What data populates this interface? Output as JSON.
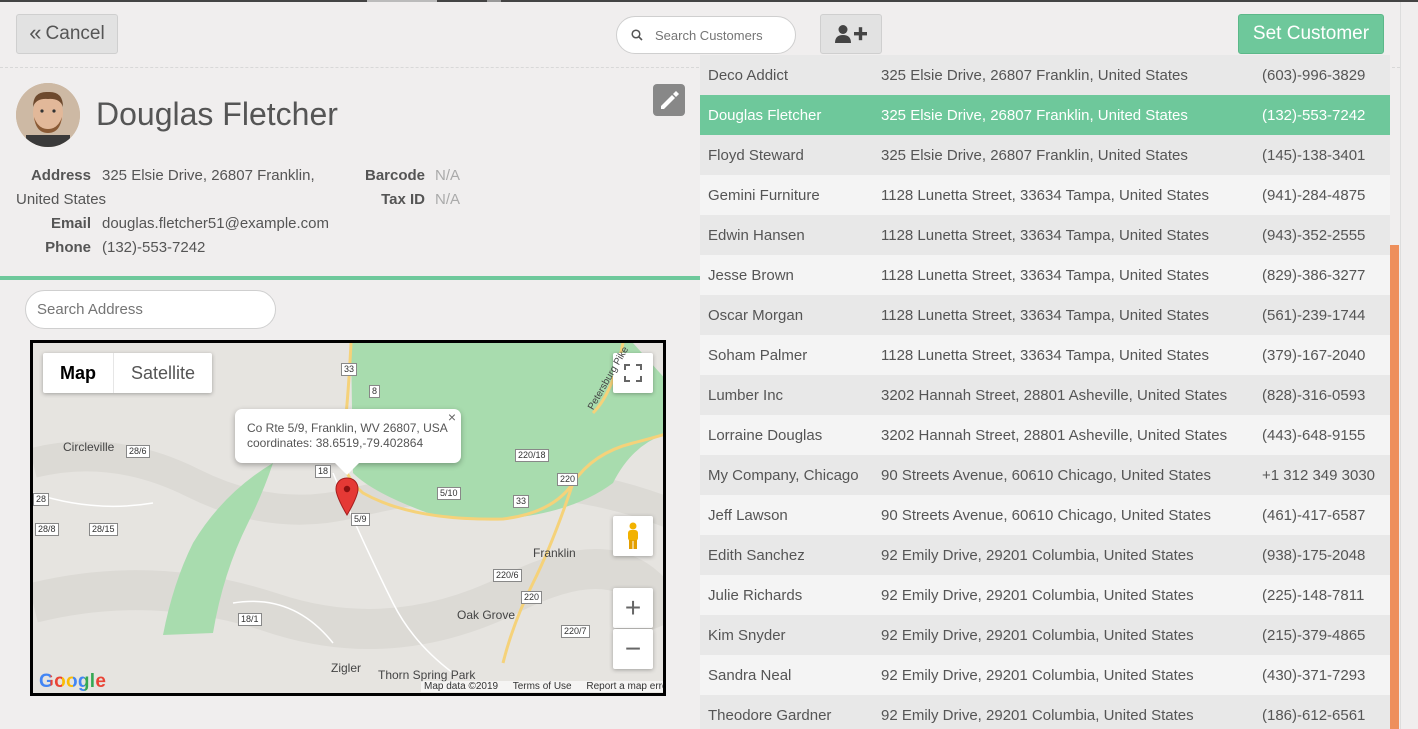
{
  "header": {
    "cancel_label": "Cancel",
    "search_placeholder": "Search Customers",
    "set_customer_label": "Set Customer"
  },
  "client": {
    "name": "Douglas Fletcher",
    "address_label": "Address",
    "address_line1": "325 Elsie Drive, 26807 Franklin,",
    "address_line2": "United States",
    "email_label": "Email",
    "email": "douglas.fletcher51@example.com",
    "phone_label": "Phone",
    "phone": "(132)-553-7242",
    "barcode_label": "Barcode",
    "barcode": "N/A",
    "taxid_label": "Tax ID",
    "taxid": "N/A",
    "search_address_placeholder": "Search Address"
  },
  "map": {
    "type_map": "Map",
    "type_satellite": "Satellite",
    "info_line1": "Co Rte 5/9, Franklin, WV 26807, USA",
    "info_line2": "coordinates: 38.6519,-79.402864",
    "places": {
      "circleville": "Circleville",
      "franklin": "Franklin",
      "oak_grove": "Oak Grove",
      "zigler": "Zigler",
      "thorn_spring_park": "Thorn Spring Park",
      "petersburg_pike": "Petersburg Pike"
    },
    "shields": {
      "r33a": "33",
      "r8": "8",
      "r286": "28/6",
      "r18": "18",
      "r220_18": "220/18",
      "r510": "5/10",
      "r220a": "220",
      "r33b": "33",
      "r59": "5/9",
      "r28": "28",
      "r288": "28/8",
      "r2815": "28/15",
      "r220_6": "220/6",
      "r220b": "220",
      "r18_1": "18/1",
      "r220_7": "220/7"
    },
    "footer_data": "Map data ©2019",
    "footer_terms": "Terms of Use",
    "footer_report": "Report a map error",
    "google": "Google"
  },
  "customers": [
    {
      "name": "Deco Addict",
      "address": "325 Elsie Drive, 26807 Franklin, United States",
      "phone": "(603)-996-3829"
    },
    {
      "name": "Douglas Fletcher",
      "address": "325 Elsie Drive, 26807 Franklin, United States",
      "phone": "(132)-553-7242"
    },
    {
      "name": "Floyd Steward",
      "address": "325 Elsie Drive, 26807 Franklin, United States",
      "phone": "(145)-138-3401"
    },
    {
      "name": "Gemini Furniture",
      "address": "1128 Lunetta Street, 33634 Tampa, United States",
      "phone": "(941)-284-4875"
    },
    {
      "name": "Edwin Hansen",
      "address": "1128 Lunetta Street, 33634 Tampa, United States",
      "phone": "(943)-352-2555"
    },
    {
      "name": "Jesse Brown",
      "address": "1128 Lunetta Street, 33634 Tampa, United States",
      "phone": "(829)-386-3277"
    },
    {
      "name": "Oscar Morgan",
      "address": "1128 Lunetta Street, 33634 Tampa, United States",
      "phone": "(561)-239-1744"
    },
    {
      "name": "Soham Palmer",
      "address": "1128 Lunetta Street, 33634 Tampa, United States",
      "phone": "(379)-167-2040"
    },
    {
      "name": "Lumber Inc",
      "address": "3202 Hannah Street, 28801 Asheville, United States",
      "phone": "(828)-316-0593"
    },
    {
      "name": "Lorraine Douglas",
      "address": "3202 Hannah Street, 28801 Asheville, United States",
      "phone": "(443)-648-9155"
    },
    {
      "name": "My Company, Chicago",
      "address": "90 Streets Avenue, 60610 Chicago, United States",
      "phone": "+1 312 349 3030"
    },
    {
      "name": "Jeff Lawson",
      "address": "90 Streets Avenue, 60610 Chicago, United States",
      "phone": "(461)-417-6587"
    },
    {
      "name": "Edith Sanchez",
      "address": "92 Emily Drive, 29201 Columbia, United States",
      "phone": "(938)-175-2048"
    },
    {
      "name": "Julie Richards",
      "address": "92 Emily Drive, 29201 Columbia, United States",
      "phone": "(225)-148-7811"
    },
    {
      "name": "Kim Snyder",
      "address": "92 Emily Drive, 29201 Columbia, United States",
      "phone": "(215)-379-4865"
    },
    {
      "name": "Sandra Neal",
      "address": "92 Emily Drive, 29201 Columbia, United States",
      "phone": "(430)-371-7293"
    },
    {
      "name": "Theodore Gardner",
      "address": "92 Emily Drive, 29201 Columbia, United States",
      "phone": "(186)-612-6561"
    }
  ],
  "selected_index": 1,
  "colors": {
    "accent": "#6ec89b",
    "scrollbar": "#ee8f5c",
    "map_park": "#a8dcae",
    "marker": "#e53935"
  },
  "icons": {
    "cancel": "double-chevron-left-icon",
    "search": "search-icon",
    "add_user": "add-user-icon",
    "edit": "pencil-icon",
    "fullscreen": "fullscreen-icon",
    "pegman": "pegman-icon",
    "marker": "map-marker-icon"
  }
}
